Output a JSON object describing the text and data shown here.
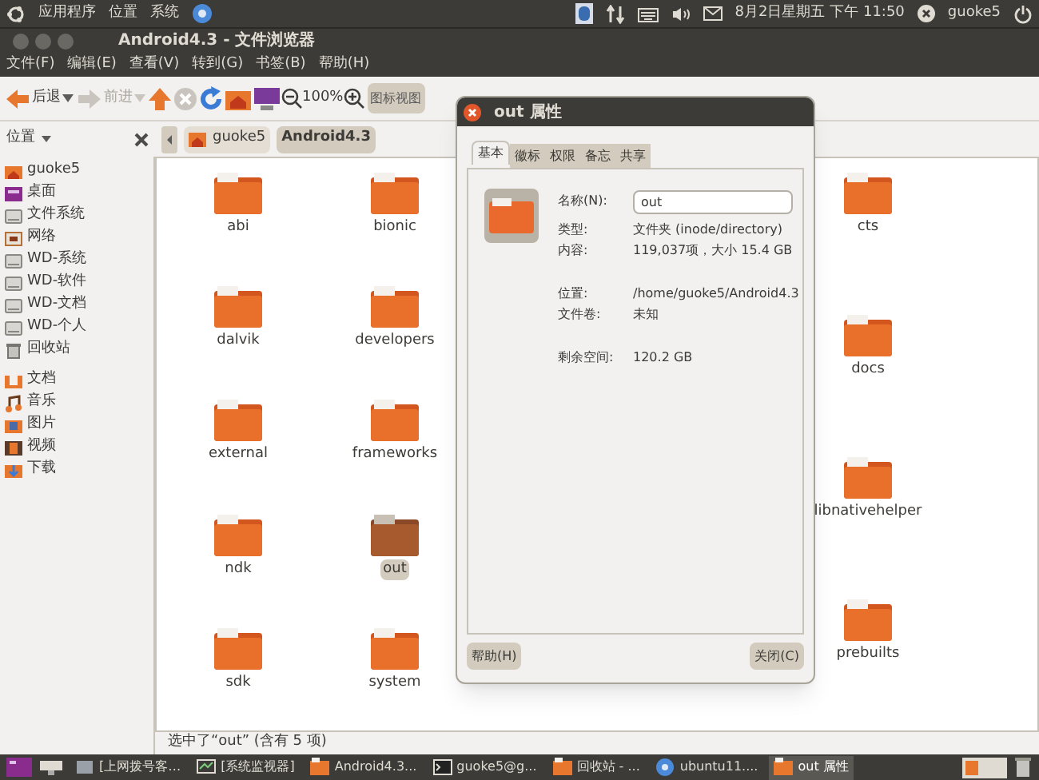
{
  "top_panel": {
    "menus": [
      "应用程序",
      "位置",
      "系统"
    ],
    "datetime": "8月2日星期五 下午 11:50",
    "user": "guoke5"
  },
  "window": {
    "title": "Android4.3 - 文件浏览器"
  },
  "menubar": [
    "文件(F)",
    "编辑(E)",
    "查看(V)",
    "转到(G)",
    "书签(B)",
    "帮助(H)"
  ],
  "toolbar": {
    "back": {
      "label": "后退",
      "disabled": false
    },
    "forward": {
      "label": "前进",
      "disabled": true
    },
    "zoom": "100%",
    "view": "图标视图"
  },
  "location": {
    "sidebar_title": "位置",
    "path": [
      {
        "label": "guoke5",
        "selected": false
      },
      {
        "label": "Android4.3",
        "selected": true
      }
    ]
  },
  "sidebar": {
    "items": [
      {
        "label": "guoke5",
        "kind": "home"
      },
      {
        "label": "桌面",
        "kind": "desktop"
      },
      {
        "label": "文件系统",
        "kind": "drive"
      },
      {
        "label": "网络",
        "kind": "network"
      },
      {
        "label": "WD-系统",
        "kind": "drive"
      },
      {
        "label": "WD-软件",
        "kind": "drive"
      },
      {
        "label": "WD-文档",
        "kind": "drive"
      },
      {
        "label": "WD-个人",
        "kind": "drive"
      },
      {
        "label": "回收站",
        "kind": "trash"
      }
    ],
    "bookmarks": [
      {
        "label": "文档",
        "kind": "docs"
      },
      {
        "label": "音乐",
        "kind": "music"
      },
      {
        "label": "图片",
        "kind": "pictures"
      },
      {
        "label": "视频",
        "kind": "video"
      },
      {
        "label": "下载",
        "kind": "download"
      }
    ]
  },
  "files_left": [
    {
      "name": "abi",
      "selected": false
    },
    {
      "name": "bionic",
      "selected": false
    },
    {
      "name": "dalvik",
      "selected": false
    },
    {
      "name": "developers",
      "selected": false
    },
    {
      "name": "external",
      "selected": false
    },
    {
      "name": "frameworks",
      "selected": false
    },
    {
      "name": "ndk",
      "selected": false
    },
    {
      "name": "out",
      "selected": true
    },
    {
      "name": "sdk",
      "selected": false
    },
    {
      "name": "system",
      "selected": false
    }
  ],
  "files_right": [
    {
      "name": "cts",
      "selected": false
    },
    {
      "name": "docs",
      "selected": false
    },
    {
      "name": "libnativehelper",
      "selected": false
    },
    {
      "name": "prebuilts",
      "selected": false
    }
  ],
  "status_bar": "选中了“out” (含有 5 项)",
  "dialog": {
    "title": "out 属性",
    "tabs": [
      {
        "label": "基本",
        "selected": true
      },
      {
        "label": "徽标",
        "selected": false
      },
      {
        "label": "权限",
        "selected": false
      },
      {
        "label": "备忘",
        "selected": false
      },
      {
        "label": "共享",
        "selected": false
      }
    ],
    "name_label": "名称(N):",
    "name_value": "out",
    "field_groups": [
      [
        {
          "label": "类型:",
          "value": "文件夹 (inode/directory)"
        },
        {
          "label": "内容:",
          "value": "119,037项，大小 15.4 GB"
        }
      ],
      [
        {
          "label": "位置:",
          "value": "/home/guoke5/Android4.3"
        },
        {
          "label": "文件卷:",
          "value": "未知"
        }
      ],
      [
        {
          "label": "剩余空间:",
          "value": "120.2 GB"
        }
      ]
    ],
    "help_button": "帮助(H)",
    "close_button": "关闭(C)"
  },
  "taskbar": [
    {
      "label": "[上网拨号客…",
      "kind": "window",
      "selected": false
    },
    {
      "label": "[系统监视器]",
      "kind": "monitor",
      "selected": false
    },
    {
      "label": "Android4.3...",
      "kind": "folder",
      "selected": false
    },
    {
      "label": "guoke5@g...",
      "kind": "terminal",
      "selected": false
    },
    {
      "label": "回收站 - ...",
      "kind": "folder",
      "selected": false
    },
    {
      "label": "ubuntu11....",
      "kind": "browser",
      "selected": false
    },
    {
      "label": "out 属性",
      "kind": "folder",
      "selected": true
    }
  ]
}
